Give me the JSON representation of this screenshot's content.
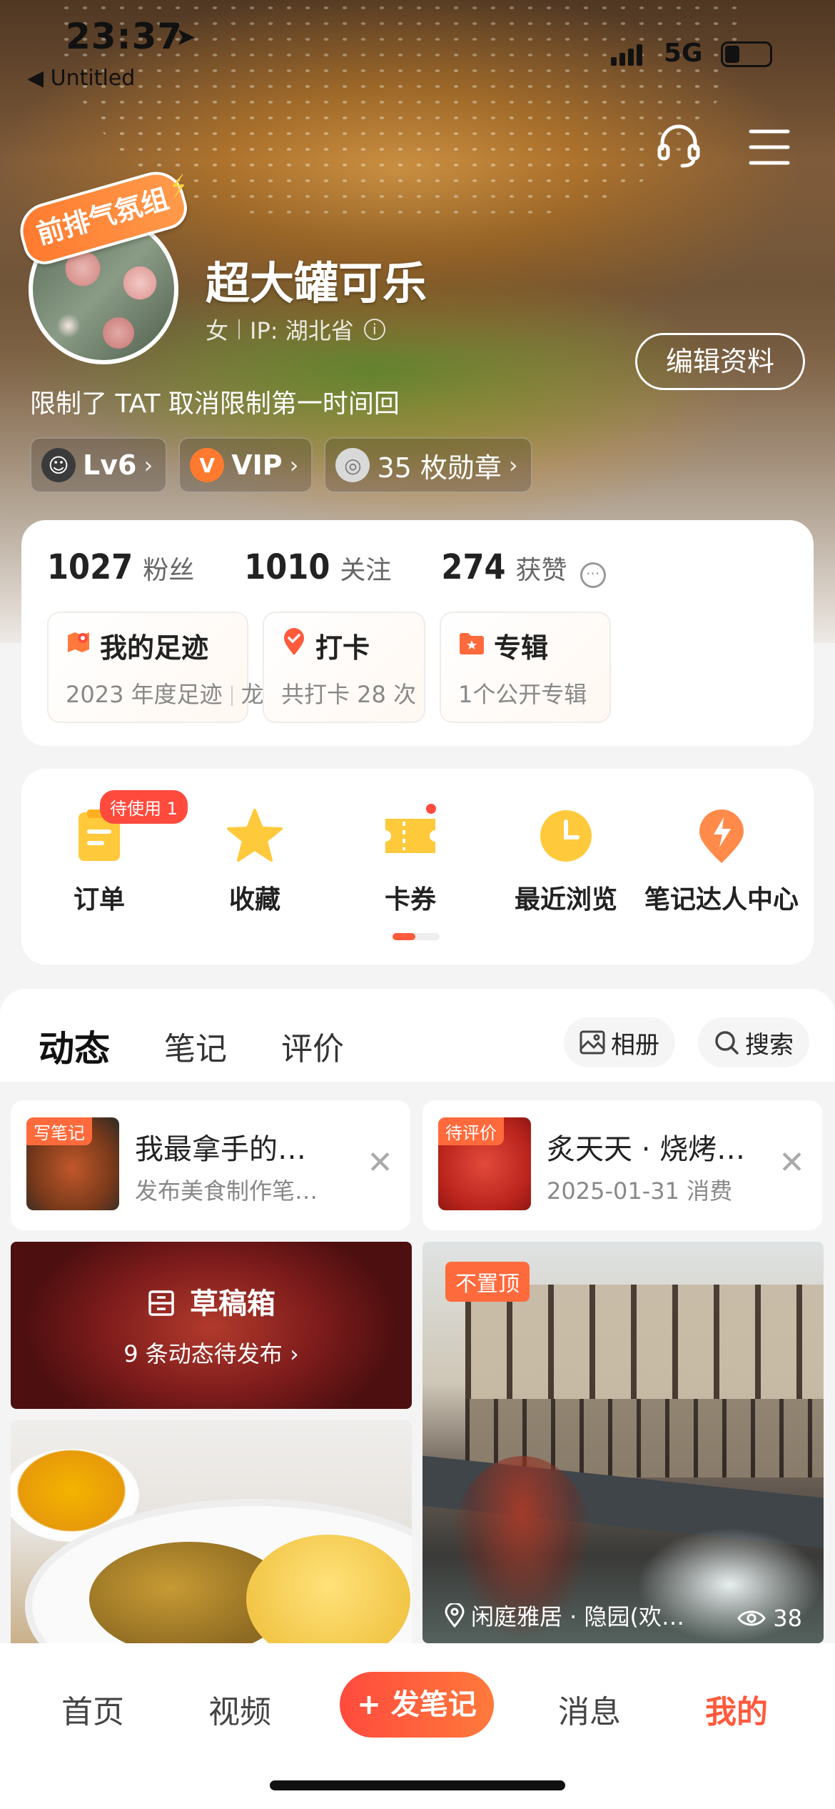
{
  "status_bar": {
    "time": "23:37",
    "back_label": "◀ Untitled",
    "network": "5G"
  },
  "profile": {
    "ribbon": "前排气氛组",
    "nickname": "超大罐可乐",
    "gender": "女",
    "ip": "IP: 湖北省",
    "edit_label": "编辑资料",
    "bio": "限制了 TAT   取消限制第一时间回",
    "chips": {
      "level": "Lv6",
      "vip": "VIP",
      "medals": "35 枚勋章"
    }
  },
  "stats": [
    {
      "num": "1027",
      "label": "粉丝"
    },
    {
      "num": "1010",
      "label": "关注"
    },
    {
      "num": "274",
      "label": "获赞"
    }
  ],
  "tiles": [
    {
      "title": "我的足迹",
      "sub1": "2023 年度足迹",
      "sub2": "龙年新春"
    },
    {
      "title": "打卡",
      "sub1": "共打卡 28 次"
    },
    {
      "title": "专辑",
      "sub1": "1个公开专辑"
    }
  ],
  "quick": [
    {
      "label": "订单",
      "badge": "待使用 1"
    },
    {
      "label": "收藏"
    },
    {
      "label": "卡券"
    },
    {
      "label": "最近浏览"
    },
    {
      "label": "笔记达人中心"
    }
  ],
  "feed_tabs": [
    "动态",
    "笔记",
    "评价"
  ],
  "feed_actions": {
    "album": "相册",
    "search": "搜索"
  },
  "mini_cards": [
    {
      "tag": "写笔记",
      "title": "我最拿手的…",
      "sub": "发布美食制作笔…"
    },
    {
      "tag": "待评价",
      "title": "炙天天 · 烧烤…",
      "sub": "2025-01-31 消费"
    }
  ],
  "draft": {
    "title": "草稿箱",
    "sub": "9 条动态待发布 ›"
  },
  "post": {
    "tag": "不置顶",
    "location": "闲庭雅居 · 隐园(欢…",
    "views": "38"
  },
  "tabbar": {
    "home": "首页",
    "video": "视频",
    "post": "+ 发笔记",
    "messages": "消息",
    "mine": "我的"
  },
  "colors": {
    "accent": "#ff5a3c",
    "badge": "#ff4a3d"
  }
}
